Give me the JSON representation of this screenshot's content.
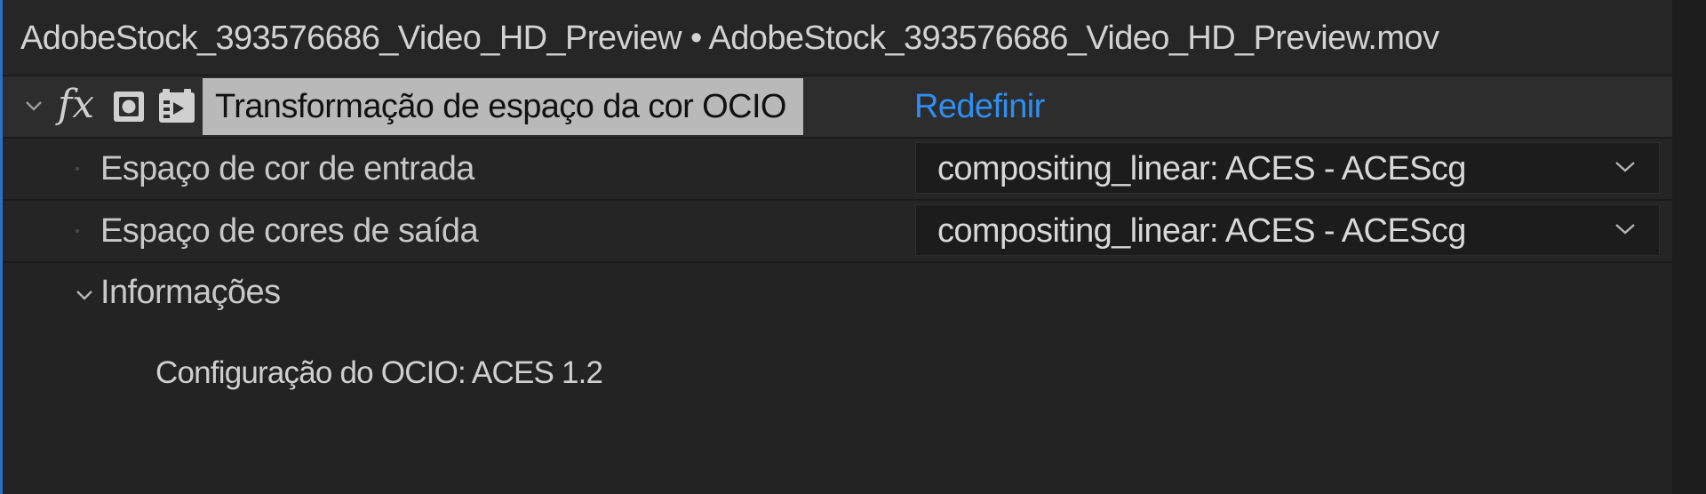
{
  "title_bar": {
    "text": "AdobeStock_393576686_Video_HD_Preview • AdobeStock_393576686_Video_HD_Preview.mov"
  },
  "effect": {
    "twirl_icon": "chevron-down-icon",
    "fx_label": "fx",
    "mask_icon": "mask-icon",
    "layer_icon": "layer-icon",
    "name": "Transformação de espaço da cor OCIO",
    "reset_label": "Redefinir"
  },
  "properties": [
    {
      "label": "Espaço de cor de entrada",
      "value": "compositing_linear: ACES - ACEScg"
    },
    {
      "label": "Espaço de cores de saída",
      "value": "compositing_linear: ACES - ACEScg"
    }
  ],
  "info": {
    "label": "Informações",
    "text": "Configuração do OCIO: ACES 1.2"
  },
  "colors": {
    "background": "#232323",
    "accent": "#2f8ef0",
    "effect_name_bg": "#b9b9b9"
  }
}
